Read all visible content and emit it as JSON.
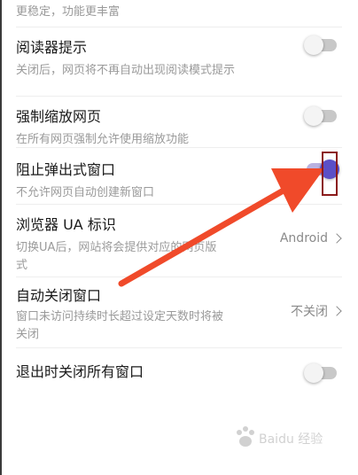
{
  "top_note": "更稳定，功能更丰富",
  "settings": {
    "reader_hint": {
      "title": "阅读器提示",
      "desc": "关闭后，网页将不再自动出现阅读模式提示",
      "enabled": false
    },
    "force_zoom": {
      "title": "强制缩放网页",
      "desc": "在所有网页强制允许使用缩放功能",
      "enabled": false
    },
    "block_popups": {
      "title": "阻止弹出式窗口",
      "desc": "不允许网页自动创建新窗口",
      "enabled": true
    },
    "user_agent": {
      "title": "浏览器 UA 标识",
      "desc": "切换UA后，网站将会提供对应的网页版式",
      "value": "Android"
    },
    "auto_close": {
      "title": "自动关闭窗口",
      "desc": "窗口未访问持续时长超过设定天数时将被关闭",
      "value": "不关闭"
    },
    "close_on_exit": {
      "title": "退出时关闭所有窗口",
      "enabled": false
    }
  },
  "colors": {
    "toggle_on": "#5b4fc7",
    "annotation_arrow": "#f04a2a",
    "annotation_box": "#8b1a1a"
  },
  "icons": {
    "chevron": "chevron-right-icon",
    "watermark": "baidu-jingyan-logo"
  },
  "watermark_text": "Baidu 经验"
}
